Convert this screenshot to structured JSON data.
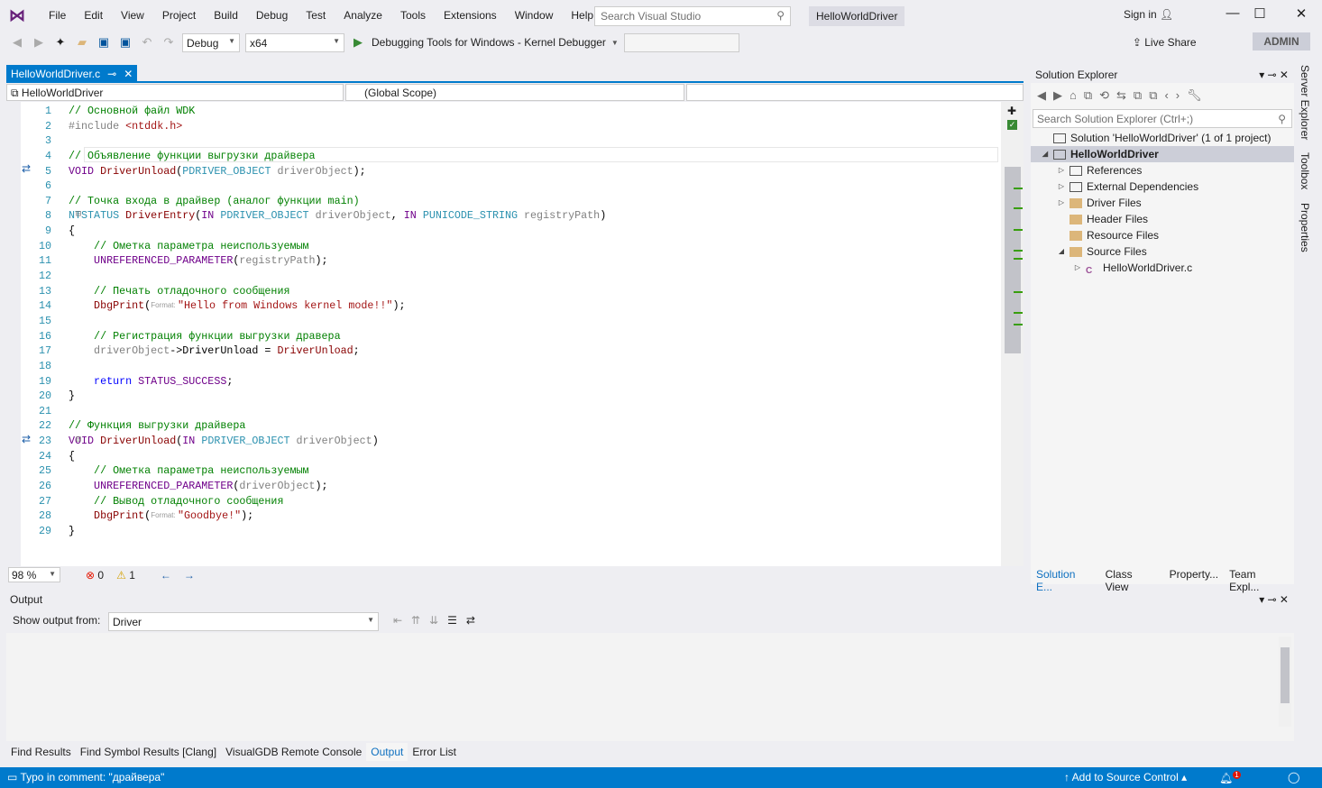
{
  "menu": [
    "File",
    "Edit",
    "View",
    "Project",
    "Build",
    "Debug",
    "Test",
    "Analyze",
    "Tools",
    "Extensions",
    "Window",
    "Help"
  ],
  "search": {
    "placeholder": "Search Visual Studio"
  },
  "solution_title": "HelloWorldDriver",
  "sign_in": "Sign in",
  "toolbar": {
    "config": "Debug",
    "platform": "x64",
    "debugger": "Debugging Tools for Windows - Kernel Debugger",
    "admin": "ADMIN",
    "live_share": "Live Share"
  },
  "editor": {
    "tab": "HelloWorldDriver.c",
    "nav_project": "HelloWorldDriver",
    "nav_scope": "(Global Scope)",
    "zoom": "98 %",
    "errors": "0",
    "warnings": "1",
    "lines": [
      [
        [
          "// Основной файл WDK",
          "cm"
        ]
      ],
      [
        [
          "#include ",
          "pp"
        ],
        [
          "<ntddk.h>",
          "str"
        ]
      ],
      [],
      [
        [
          "// Объявление функции выгрузки драйвера",
          "cm"
        ]
      ],
      [
        [
          "VOID ",
          "mac"
        ],
        [
          "DriverUnload",
          "fn"
        ],
        [
          "(",
          "tx"
        ],
        [
          "PDRIVER_OBJECT ",
          "typ"
        ],
        [
          "driverObject",
          "par"
        ],
        [
          ");",
          "tx"
        ]
      ],
      [],
      [
        [
          "// Точка входа в драйвер (аналог функции main)",
          "cm"
        ]
      ],
      [
        [
          "NTSTATUS ",
          "typ"
        ],
        [
          "DriverEntry",
          "fn"
        ],
        [
          "(",
          "tx"
        ],
        [
          "IN ",
          "mac"
        ],
        [
          "PDRIVER_OBJECT ",
          "typ"
        ],
        [
          "driverObject",
          "par"
        ],
        [
          ", ",
          "tx"
        ],
        [
          "IN ",
          "mac"
        ],
        [
          "PUNICODE_STRING ",
          "typ"
        ],
        [
          "registryPath",
          "par"
        ],
        [
          ")",
          "tx"
        ]
      ],
      [
        [
          "{",
          "tx"
        ]
      ],
      [
        [
          "    // Ометка параметра неиспользуемым",
          "cm"
        ]
      ],
      [
        [
          "    UNREFERENCED_PARAMETER",
          "mac"
        ],
        [
          "(",
          "tx"
        ],
        [
          "registryPath",
          "par"
        ],
        [
          ");",
          "tx"
        ]
      ],
      [],
      [
        [
          "    // Печать отладочного сообщения",
          "cm"
        ]
      ],
      [
        [
          "    DbgPrint",
          "fn"
        ],
        [
          "(",
          "tx"
        ],
        [
          "Format: ",
          "hint"
        ],
        [
          "\"Hello from Windows kernel mode!!\"",
          "str"
        ],
        [
          ");",
          "tx"
        ]
      ],
      [],
      [
        [
          "    // Регистрация функции выгрузки дравера",
          "cm"
        ]
      ],
      [
        [
          "    driverObject",
          "par"
        ],
        [
          "->",
          "tx"
        ],
        [
          "DriverUnload",
          "tx"
        ],
        [
          " = ",
          "tx"
        ],
        [
          "DriverUnload",
          "fn"
        ],
        [
          ";",
          "tx"
        ]
      ],
      [],
      [
        [
          "    return ",
          "kw"
        ],
        [
          "STATUS_SUCCESS",
          "mac"
        ],
        [
          ";",
          "tx"
        ]
      ],
      [
        [
          "}",
          "tx"
        ]
      ],
      [],
      [
        [
          "// Функция выгрузки драйвера",
          "cm"
        ]
      ],
      [
        [
          "VOID ",
          "mac"
        ],
        [
          "DriverUnload",
          "fn"
        ],
        [
          "(",
          "tx"
        ],
        [
          "IN ",
          "mac"
        ],
        [
          "PDRIVER_OBJECT ",
          "typ"
        ],
        [
          "driverObject",
          "par"
        ],
        [
          ")",
          "tx"
        ]
      ],
      [
        [
          "{",
          "tx"
        ]
      ],
      [
        [
          "    // Ометка параметра неиспользуемым",
          "cm"
        ]
      ],
      [
        [
          "    UNREFERENCED_PARAMETER",
          "mac"
        ],
        [
          "(",
          "tx"
        ],
        [
          "driverObject",
          "par"
        ],
        [
          ");",
          "tx"
        ]
      ],
      [
        [
          "    // Вывод отладочного сообщения",
          "cm"
        ]
      ],
      [
        [
          "    DbgPrint",
          "fn"
        ],
        [
          "(",
          "tx"
        ],
        [
          "Format: ",
          "hint"
        ],
        [
          "\"Goodbye!\"",
          "str"
        ],
        [
          ");",
          "tx"
        ]
      ],
      [
        [
          "}",
          "tx"
        ]
      ]
    ]
  },
  "solution_explorer": {
    "title": "Solution Explorer",
    "search_placeholder": "Search Solution Explorer (Ctrl+;)",
    "nodes": [
      {
        "label": "Solution 'HelloWorldDriver' (1 of 1 project)",
        "level": 0,
        "exp": "",
        "icon": "solution"
      },
      {
        "label": "HelloWorldDriver",
        "level": 0,
        "exp": "◢",
        "icon": "project",
        "selected": true
      },
      {
        "label": "References",
        "level": 1,
        "exp": "▷",
        "icon": "references"
      },
      {
        "label": "External Dependencies",
        "level": 1,
        "exp": "▷",
        "icon": "external"
      },
      {
        "label": "Driver Files",
        "level": 1,
        "exp": "▷",
        "icon": "folder"
      },
      {
        "label": "Header Files",
        "level": 1,
        "exp": "",
        "icon": "folder"
      },
      {
        "label": "Resource Files",
        "level": 1,
        "exp": "",
        "icon": "folder"
      },
      {
        "label": "Source Files",
        "level": 1,
        "exp": "◢",
        "icon": "folder"
      },
      {
        "label": "HelloWorldDriver.c",
        "level": 2,
        "exp": "▷",
        "icon": "c-file"
      }
    ],
    "tabs": [
      "Solution E...",
      "Class View",
      "Property...",
      "Team Expl..."
    ]
  },
  "side_tabs": [
    "Server Explorer",
    "Toolbox",
    "Properties"
  ],
  "output": {
    "title": "Output",
    "show_from_label": "Show output from:",
    "source": "Driver"
  },
  "bottom_tabs": [
    "Find Results",
    "Find Symbol Results [Clang]",
    "VisualGDB Remote Console",
    "Output",
    "Error List"
  ],
  "status": {
    "message": "Typo in comment: \"драйвера\"",
    "source_control": "Add to Source Control",
    "notifications": "1"
  },
  "colors": {
    "accent": "#007acc",
    "comment": "#008000",
    "string": "#a31515"
  }
}
